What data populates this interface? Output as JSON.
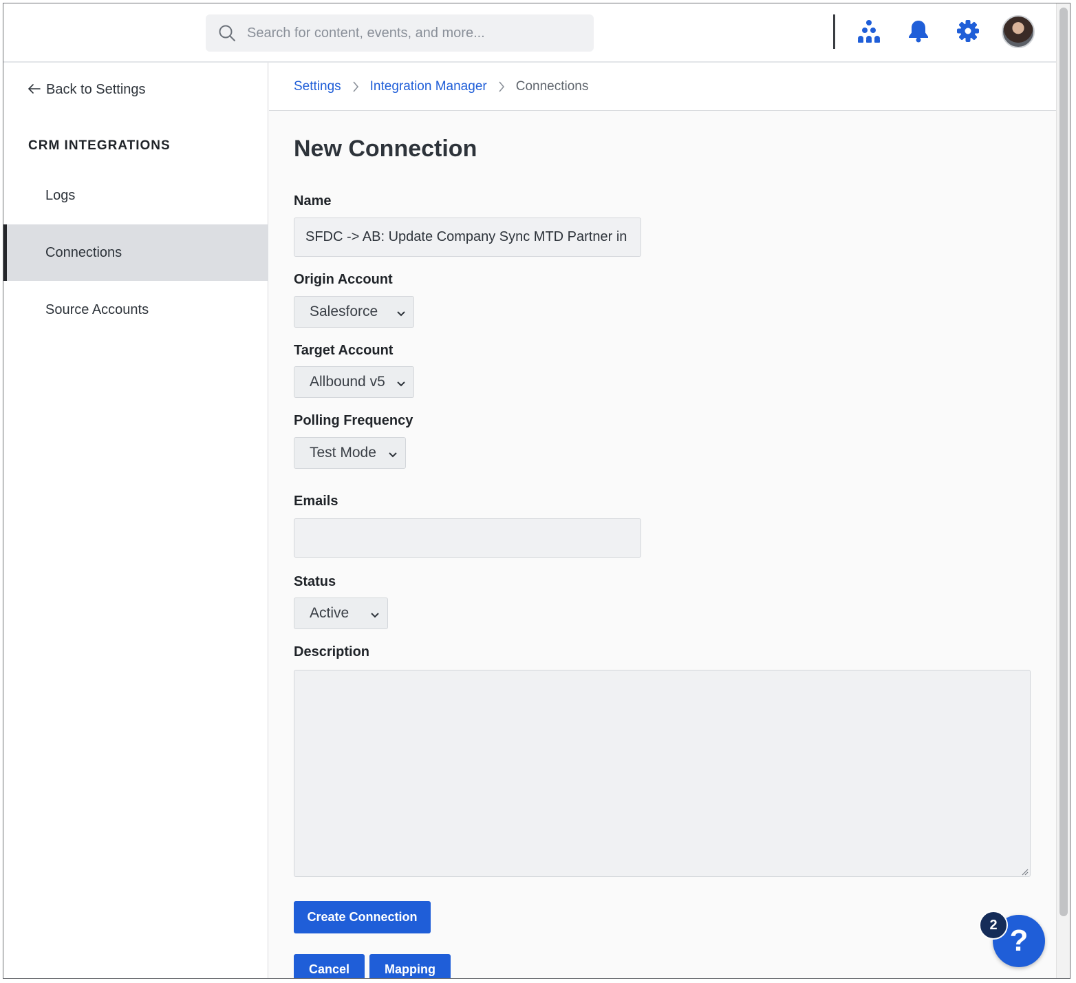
{
  "search": {
    "placeholder": "Search for content, events, and more..."
  },
  "header_icons": [
    "org-chart-icon",
    "bell-icon",
    "gear-icon",
    "avatar"
  ],
  "sidebar": {
    "back_label": "Back to Settings",
    "section_title": "CRM INTEGRATIONS",
    "items": [
      {
        "label": "Logs",
        "active": false
      },
      {
        "label": "Connections",
        "active": true
      },
      {
        "label": "Source Accounts",
        "active": false
      }
    ]
  },
  "breadcrumb": {
    "items": [
      "Settings",
      "Integration Manager",
      "Connections"
    ]
  },
  "form": {
    "title": "New Connection",
    "name_label": "Name",
    "name_value": "SFDC -> AB: Update Company Sync MTD Partner in",
    "origin_label": "Origin Account",
    "origin_value": "Salesforce",
    "target_label": "Target Account",
    "target_value": "Allbound v5",
    "polling_label": "Polling Frequency",
    "polling_value": "Test Mode",
    "emails_label": "Emails",
    "emails_value": "",
    "status_label": "Status",
    "status_value": "Active",
    "description_label": "Description",
    "description_value": ""
  },
  "buttons": {
    "create": "Create Connection",
    "cancel": "Cancel",
    "mapping": "Mapping"
  },
  "help": {
    "icon_text": "?",
    "badge_count": "2"
  },
  "colors": {
    "accent": "#1f5ed8",
    "badge": "#152c58",
    "active_nav": "#dcdee2"
  }
}
